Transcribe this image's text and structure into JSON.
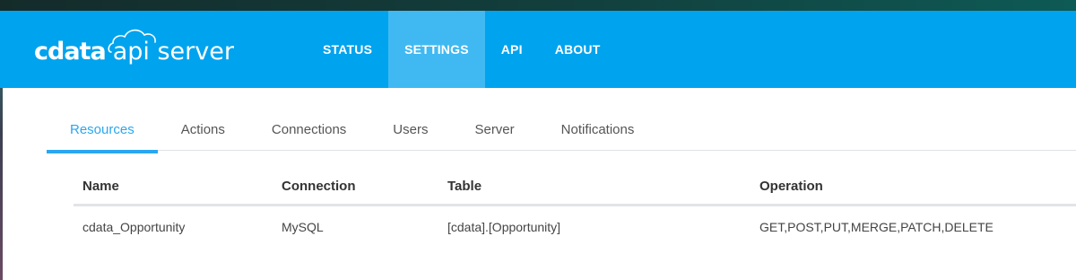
{
  "brand": {
    "logo_primary": "cdata",
    "logo_secondary": "api server",
    "header_color": "#00a3ee",
    "active_nav_color": "#40b9f2",
    "accent_color": "#2aa7f0"
  },
  "top_nav": {
    "items": [
      {
        "label": "STATUS",
        "active": false
      },
      {
        "label": "SETTINGS",
        "active": true
      },
      {
        "label": "API",
        "active": false
      },
      {
        "label": "ABOUT",
        "active": false
      }
    ]
  },
  "settings_tabs": {
    "items": [
      {
        "label": "Resources",
        "active": true
      },
      {
        "label": "Actions",
        "active": false
      },
      {
        "label": "Connections",
        "active": false
      },
      {
        "label": "Users",
        "active": false
      },
      {
        "label": "Server",
        "active": false
      },
      {
        "label": "Notifications",
        "active": false
      }
    ]
  },
  "resources_table": {
    "columns": [
      "Name",
      "Connection",
      "Table",
      "Operation"
    ],
    "rows": [
      [
        "cdata_Opportunity",
        "MySQL",
        "[cdata].[Opportunity]",
        "GET,POST,PUT,MERGE,PATCH,DELETE"
      ]
    ]
  }
}
